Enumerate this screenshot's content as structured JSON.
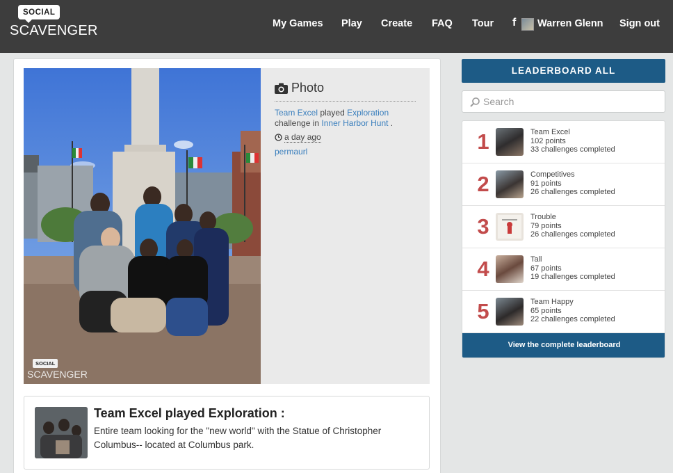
{
  "header": {
    "logo_badge": "SOCIAL",
    "logo_word": "SCAVENGER",
    "nav": [
      "My Games",
      "Play",
      "Create",
      "FAQ",
      "Tour"
    ],
    "fb_glyph": "f",
    "user_name": "Warren Glenn",
    "sign_out": "Sign out"
  },
  "post": {
    "type_label": "Photo",
    "team": "Team Excel",
    "played_word": "played",
    "challenge": "Exploration",
    "challenge_in": "challenge in",
    "hunt": "Inner Harbor Hunt",
    "period": ".",
    "time_ago": "a day ago",
    "permalink": "permaurl",
    "watermark_badge": "SOCIAL",
    "watermark_word": "SCAVENGER"
  },
  "caption": {
    "title": "Team Excel played Exploration :",
    "text": "Entire team looking for the \"new world\" with the Statue of Christopher Columbus-- located at Columbus park."
  },
  "sidebar": {
    "leaderboard_button": "LEADERBOARD ALL",
    "search_placeholder": "Search",
    "footer_link": "View the complete leaderboard",
    "entries": [
      {
        "rank": "1",
        "name": "Team Excel",
        "points": "102 points",
        "challenges": "33 challenges completed"
      },
      {
        "rank": "2",
        "name": "Competitives",
        "points": "91 points",
        "challenges": "26 challenges completed"
      },
      {
        "rank": "3",
        "name": "Trouble",
        "points": "79 points",
        "challenges": "26 challenges completed"
      },
      {
        "rank": "4",
        "name": "Tall",
        "points": "67 points",
        "challenges": "19 challenges completed"
      },
      {
        "rank": "5",
        "name": "Team Happy",
        "points": "65 points",
        "challenges": "22 challenges completed"
      }
    ]
  },
  "colors": {
    "header_bg": "#3d3d3d",
    "brand_blue": "#1d5b86",
    "rank_red": "#c24b4b",
    "link_blue": "#3a7fbd"
  }
}
